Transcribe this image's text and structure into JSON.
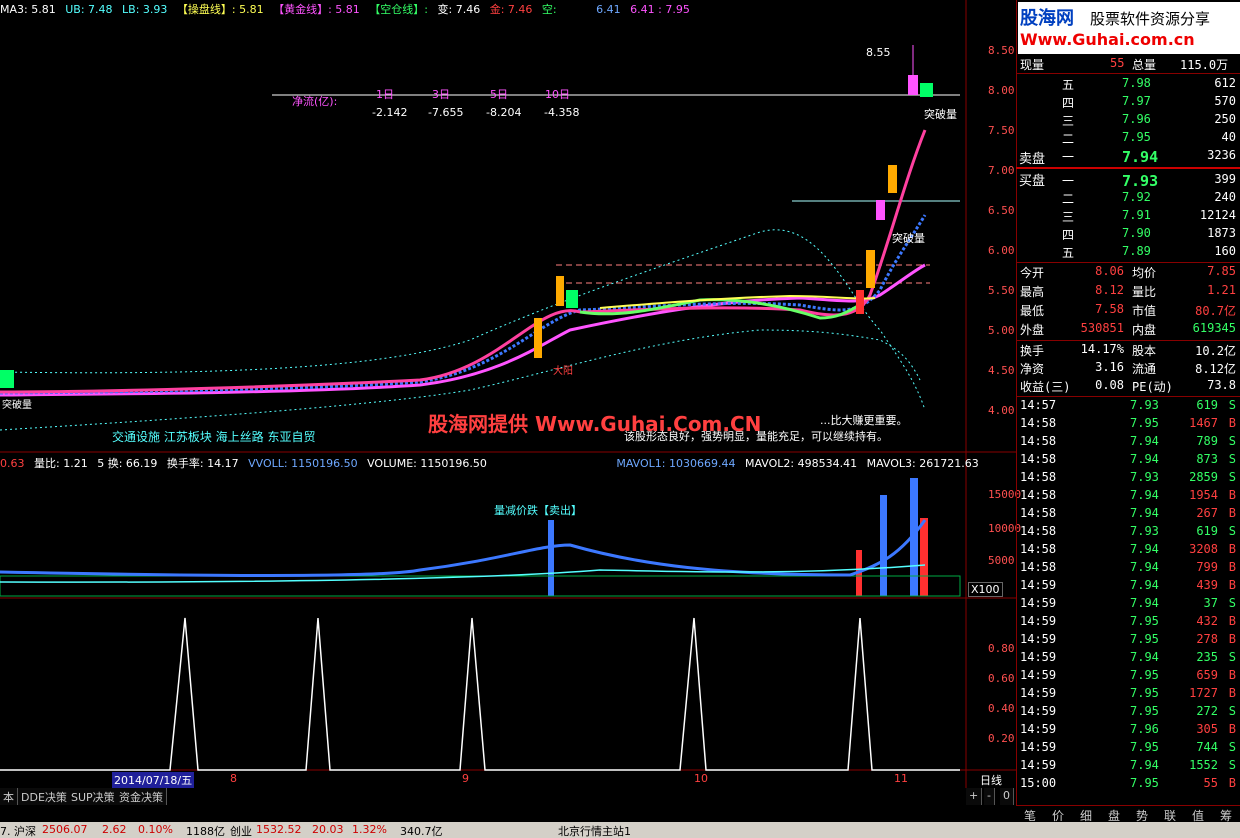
{
  "header": {
    "ma3": "MA3: 5.81",
    "ub": "UB: 7.48",
    "lb": "LB: 3.93",
    "caopan": "【操盘线】: 5.81",
    "huangjin": "【黄金线】: 5.81",
    "kongcang": "【空仓线】:",
    "bian": "变: 7.46",
    "jin": "金: 7.46",
    "kong": "空:",
    "v1": "6.41",
    "v2": "6.41 : 7.95"
  },
  "main_labels": {
    "jingliu": "净流(亿):",
    "periods": [
      "1日",
      "3日",
      "5日",
      "10日"
    ],
    "values": [
      "-2.142",
      "-7.655",
      "-8.204",
      "-4.358"
    ],
    "peak": "8.55",
    "tupo1": "突破量",
    "tupo2": "突破量",
    "tupo3": "突破量",
    "sectors": "交通设施 江苏板块 海上丝路 东亚自贸",
    "watermark": "股海网提供 Www.Guhai.Com.CN",
    "comment1": "...比大赚更重要。",
    "comment2": "该股形态良好，强势明显，量能充足，可以继续持有。",
    "red_text": "大阳",
    "price_ticks": [
      "8.50",
      "8.00",
      "7.50",
      "7.00",
      "6.50",
      "6.00",
      "5.50",
      "5.00",
      "4.50",
      "4.00"
    ]
  },
  "volume_header": {
    "a": "0.63",
    "liangbi": "量比: 1.21",
    "huan": "5 换: 66.19",
    "huanshou": "换手率: 14.17",
    "vvol": "VVOLL: 1150196.50",
    "volume": "VOLUME: 1150196.50",
    "mavol1": "MAVOL1: 1030669.44",
    "mavol2": "MAVOL2: 498534.41",
    "mavol3": "MAVOL3: 261721.63",
    "note": "量减价跌【卖出】",
    "ticks": [
      "15000",
      "10000",
      "5000"
    ],
    "unit": "X100"
  },
  "indicator": {
    "ticks": [
      "0.80",
      "0.60",
      "0.40",
      "0.20"
    ]
  },
  "date_axis": {
    "date": "2014/07/18/五",
    "months": [
      "8",
      "9",
      "10",
      "11"
    ],
    "period": "日线"
  },
  "bottom_tabs": [
    "本",
    "DDE决策",
    "SUP决策",
    "资金决策"
  ],
  "zoom": {
    "plus": "+",
    "minus": "-",
    "zero": "0"
  },
  "quote": {
    "logo1": "股海网",
    "logo2": "股票软件资源分享",
    "logo3": "Www.Guhai.com.cn",
    "xianliang_label": "现量",
    "xianliang": "55",
    "zongliang_label": "总量",
    "zongliang": "115.0万",
    "sell": [
      {
        "level": "五",
        "price": "7.98",
        "vol": "612"
      },
      {
        "level": "四",
        "price": "7.97",
        "vol": "570"
      },
      {
        "level": "三",
        "price": "7.96",
        "vol": "250"
      },
      {
        "level": "二",
        "price": "7.95",
        "vol": "40"
      },
      {
        "level": "一",
        "price": "7.94",
        "vol": "3236"
      }
    ],
    "maipan": "卖盘",
    "mairupan": "买盘",
    "buy": [
      {
        "level": "一",
        "price": "7.93",
        "vol": "399"
      },
      {
        "level": "二",
        "price": "7.92",
        "vol": "240"
      },
      {
        "level": "三",
        "price": "7.91",
        "vol": "12124"
      },
      {
        "level": "四",
        "price": "7.90",
        "vol": "1873"
      },
      {
        "level": "五",
        "price": "7.89",
        "vol": "160"
      }
    ],
    "stats": [
      {
        "k1": "今开",
        "v1": "8.06",
        "k2": "均价",
        "v2": "7.85"
      },
      {
        "k1": "最高",
        "v1": "8.12",
        "k2": "量比",
        "v2": "1.21"
      },
      {
        "k1": "最低",
        "v1": "7.58",
        "k2": "市值",
        "v2": "80.7亿"
      },
      {
        "k1": "外盘",
        "v1": "530851",
        "k2": "内盘",
        "v2": "619345"
      }
    ],
    "stats2": [
      {
        "k1": "换手",
        "v1": "14.17%",
        "k2": "股本",
        "v2": "10.2亿"
      },
      {
        "k1": "净资",
        "v1": "3.16",
        "k2": "流通",
        "v2": "8.12亿"
      },
      {
        "k1": "收益(三)",
        "v1": "0.08",
        "k2": "PE(动)",
        "v2": "73.8"
      }
    ],
    "ticks": [
      {
        "t": "14:57",
        "p": "7.93",
        "v": "619",
        "s": "S"
      },
      {
        "t": "14:58",
        "p": "7.95",
        "v": "1467",
        "s": "B"
      },
      {
        "t": "14:58",
        "p": "7.94",
        "v": "789",
        "s": "S"
      },
      {
        "t": "14:58",
        "p": "7.94",
        "v": "873",
        "s": "S"
      },
      {
        "t": "14:58",
        "p": "7.93",
        "v": "2859",
        "s": "S"
      },
      {
        "t": "14:58",
        "p": "7.94",
        "v": "1954",
        "s": "B"
      },
      {
        "t": "14:58",
        "p": "7.94",
        "v": "267",
        "s": "B"
      },
      {
        "t": "14:58",
        "p": "7.93",
        "v": "619",
        "s": "S"
      },
      {
        "t": "14:58",
        "p": "7.94",
        "v": "3208",
        "s": "B"
      },
      {
        "t": "14:58",
        "p": "7.94",
        "v": "799",
        "s": "B"
      },
      {
        "t": "14:59",
        "p": "7.94",
        "v": "439",
        "s": "B"
      },
      {
        "t": "14:59",
        "p": "7.94",
        "v": "37",
        "s": "S"
      },
      {
        "t": "14:59",
        "p": "7.95",
        "v": "432",
        "s": "B"
      },
      {
        "t": "14:59",
        "p": "7.95",
        "v": "278",
        "s": "B"
      },
      {
        "t": "14:59",
        "p": "7.94",
        "v": "235",
        "s": "S"
      },
      {
        "t": "14:59",
        "p": "7.95",
        "v": "659",
        "s": "B"
      },
      {
        "t": "14:59",
        "p": "7.95",
        "v": "1727",
        "s": "B"
      },
      {
        "t": "14:59",
        "p": "7.95",
        "v": "272",
        "s": "S"
      },
      {
        "t": "14:59",
        "p": "7.96",
        "v": "305",
        "s": "B"
      },
      {
        "t": "14:59",
        "p": "7.95",
        "v": "744",
        "s": "S"
      },
      {
        "t": "14:59",
        "p": "7.94",
        "v": "1552",
        "s": "S"
      },
      {
        "t": "15:00",
        "p": "7.95",
        "v": "55",
        "s": "B"
      }
    ],
    "right_tabs": [
      "笔",
      "价",
      "细",
      "盘",
      "势",
      "联",
      "值",
      "筹"
    ]
  },
  "status": {
    "hu_label": "7. 沪深",
    "hu": "2506.07",
    "hu_chg": "2.62",
    "hu_pct": "0.10%",
    "hu_amt": "1188亿",
    "cy_label": "创业",
    "cy": "1532.52",
    "cy_chg": "20.03",
    "cy_pct": "1.32%",
    "cy_amt": "340.7亿",
    "server": "北京行情主站1"
  },
  "colors": {
    "up": "#ff3030",
    "down": "#00ff66",
    "ma_mag": "#ff54ff",
    "ma_blue": "#3c78ff",
    "border": "#800000"
  }
}
